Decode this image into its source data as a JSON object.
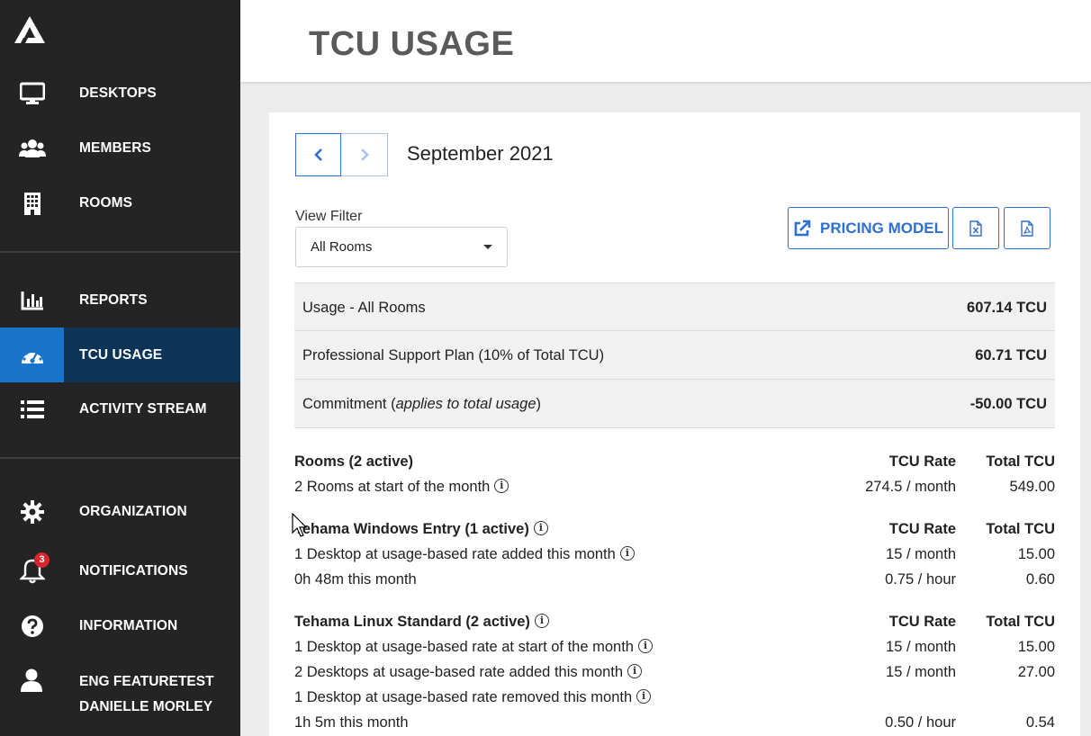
{
  "sidebar": {
    "items": [
      {
        "label": "DESKTOPS",
        "icon": "monitor-icon"
      },
      {
        "label": "MEMBERS",
        "icon": "users-icon"
      },
      {
        "label": "ROOMS",
        "icon": "building-icon"
      },
      {
        "label": "REPORTS",
        "icon": "bar-chart-icon"
      },
      {
        "label": "TCU USAGE",
        "icon": "gauge-icon",
        "active": true
      },
      {
        "label": "ACTIVITY STREAM",
        "icon": "list-icon"
      },
      {
        "label": "ORGANIZATION",
        "icon": "gear-icon"
      },
      {
        "label": "NOTIFICATIONS",
        "icon": "bell-icon"
      },
      {
        "label": "INFORMATION",
        "icon": "help-icon"
      }
    ],
    "notification_count": "3",
    "user": {
      "line1": "ENG FEATURETEST",
      "line2": "DANIELLE MORLEY"
    }
  },
  "header": {
    "title": "TCU USAGE"
  },
  "month": {
    "label": "September 2021"
  },
  "filter": {
    "label": "View Filter",
    "value": "All Rooms"
  },
  "actions": {
    "pricing_label": "PRICING MODEL"
  },
  "summary": [
    {
      "label": "Usage - All Rooms",
      "value": "607.14 TCU"
    },
    {
      "label": "Professional Support Plan (10% of Total TCU)",
      "value": "60.71 TCU"
    },
    {
      "label_pre": "Commitment (",
      "label_em": "applies to total usage",
      "label_post": ")",
      "value": "-50.00 TCU"
    }
  ],
  "columns": {
    "rate": "TCU Rate",
    "total": "Total TCU"
  },
  "sections": {
    "rooms": {
      "title": "Rooms (2 active)",
      "rows": [
        {
          "label": "2 Rooms at start of the month",
          "rate": "274.5 / month",
          "total": "549.00"
        }
      ]
    },
    "windows": {
      "title": "Tehama Windows Entry (1 active)",
      "rows": [
        {
          "label": "1 Desktop at usage-based rate added this month",
          "rate": "15 / month",
          "total": "15.00"
        },
        {
          "label": "0h 48m this month",
          "rate": "0.75 / hour",
          "total": "0.60"
        }
      ]
    },
    "linux": {
      "title": "Tehama Linux Standard (2 active)",
      "rows": [
        {
          "label": "1 Desktop at usage-based rate at start of the month",
          "rate": "15 / month",
          "total": "15.00"
        },
        {
          "label": "2 Desktops at usage-based rate added this month",
          "rate": "15 / month",
          "total": "27.00"
        },
        {
          "label": "1 Desktop at usage-based rate removed this month",
          "rate": "",
          "total": ""
        },
        {
          "label": "1h 5m this month",
          "rate": "0.50 / hour",
          "total": "0.54"
        }
      ]
    }
  }
}
